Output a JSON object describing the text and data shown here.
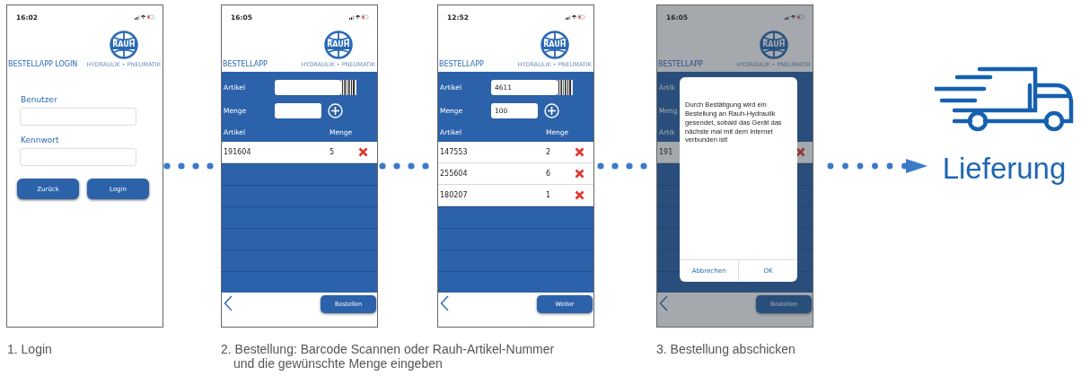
{
  "steps": [
    {
      "kind": "login",
      "time": "16:02",
      "title": "BESTELLAPP LOGIN",
      "logo": {
        "text": "RAUH",
        "tagline": "HYDRAULIK • PNEUMATIK"
      },
      "fields": [
        {
          "label": "Benutzer"
        },
        {
          "label": "Kennwort"
        }
      ],
      "buttons": [
        "Zurück",
        "Login"
      ]
    },
    {
      "kind": "order",
      "time": "16:05",
      "title": "BESTELLAPP",
      "logo": {
        "text": "RAUH",
        "tagline": "HYDRAULIK • PNEUMATIK"
      },
      "form": {
        "article": {
          "label": "Artikel"
        },
        "quantity": {
          "label": "Menge"
        }
      },
      "columns": [
        "Artikel",
        "Menge"
      ],
      "rows": [
        {
          "article": "191604",
          "quantity": "5"
        }
      ],
      "button": "Bestellen"
    },
    {
      "kind": "order",
      "time": "12:52",
      "title": "BESTELLAPP",
      "logo": {
        "text": "RAUH",
        "tagline": "HYDRAULIK • PNEUMATIK"
      },
      "form": {
        "article": {
          "label": "Artikel",
          "value": "4611"
        },
        "quantity": {
          "label": "Menge",
          "value": "100"
        }
      },
      "columns": [
        "Artikel",
        "Menge"
      ],
      "rows": [
        {
          "article": "147553",
          "quantity": "2"
        },
        {
          "article": "255604",
          "quantity": "6"
        },
        {
          "article": "180207",
          "quantity": "1"
        }
      ],
      "button": "Weiter"
    },
    {
      "kind": "confirm",
      "time": "16:05",
      "title": "BESTELLAPP",
      "logo": {
        "text": "RAUH",
        "tagline": "HYDRAULIK • PNEUMATIK"
      },
      "form": {
        "article": {
          "label": "Artik"
        },
        "quantity": {
          "label": "Meng"
        }
      },
      "columns": [
        "Artik"
      ],
      "rows": [
        {
          "article": "191"
        }
      ],
      "button": "Bestellen",
      "dialog": {
        "message": "Durch Bestätigung wird ein Bestellung an Rauh-Hydraulik gesendet, sobald das Gerät das nächste mal mit dem Internet verbunden ist!",
        "buttons": [
          "Abbrechen",
          "OK"
        ]
      }
    }
  ],
  "delivery": {
    "label": "Lieferung"
  },
  "captions": [
    "1. Login",
    "2. Bestellung: Barcode Scannen oder Rauh-Artikel-Nummer und die gewünschte Menge eingeben",
    "3. Bestellung abschicken"
  ]
}
